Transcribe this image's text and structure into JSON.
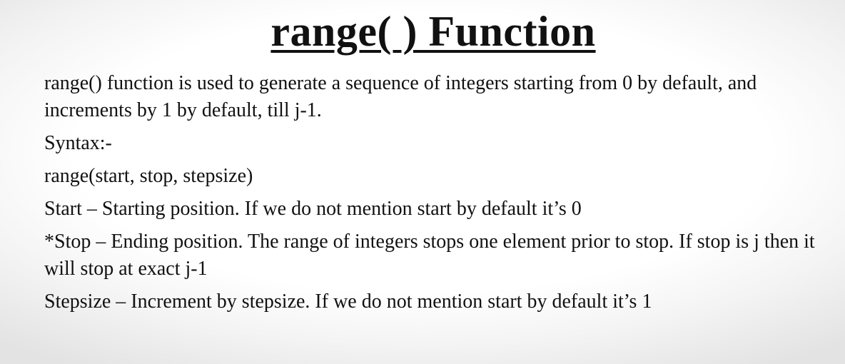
{
  "slide": {
    "title": "range( ) Function",
    "paragraphs": [
      "range() function is used to generate a sequence of integers starting from 0 by default, and increments by 1 by default, till j-1.",
      "Syntax:-",
      "range(start, stop, stepsize)",
      "Start – Starting position. If we do not mention start by default it’s 0",
      "*Stop – Ending position. The range of integers stops one element prior to stop. If stop is j then it will stop at exact j-1",
      "Stepsize – Increment by stepsize. If we do not mention start by default it’s 1"
    ]
  }
}
